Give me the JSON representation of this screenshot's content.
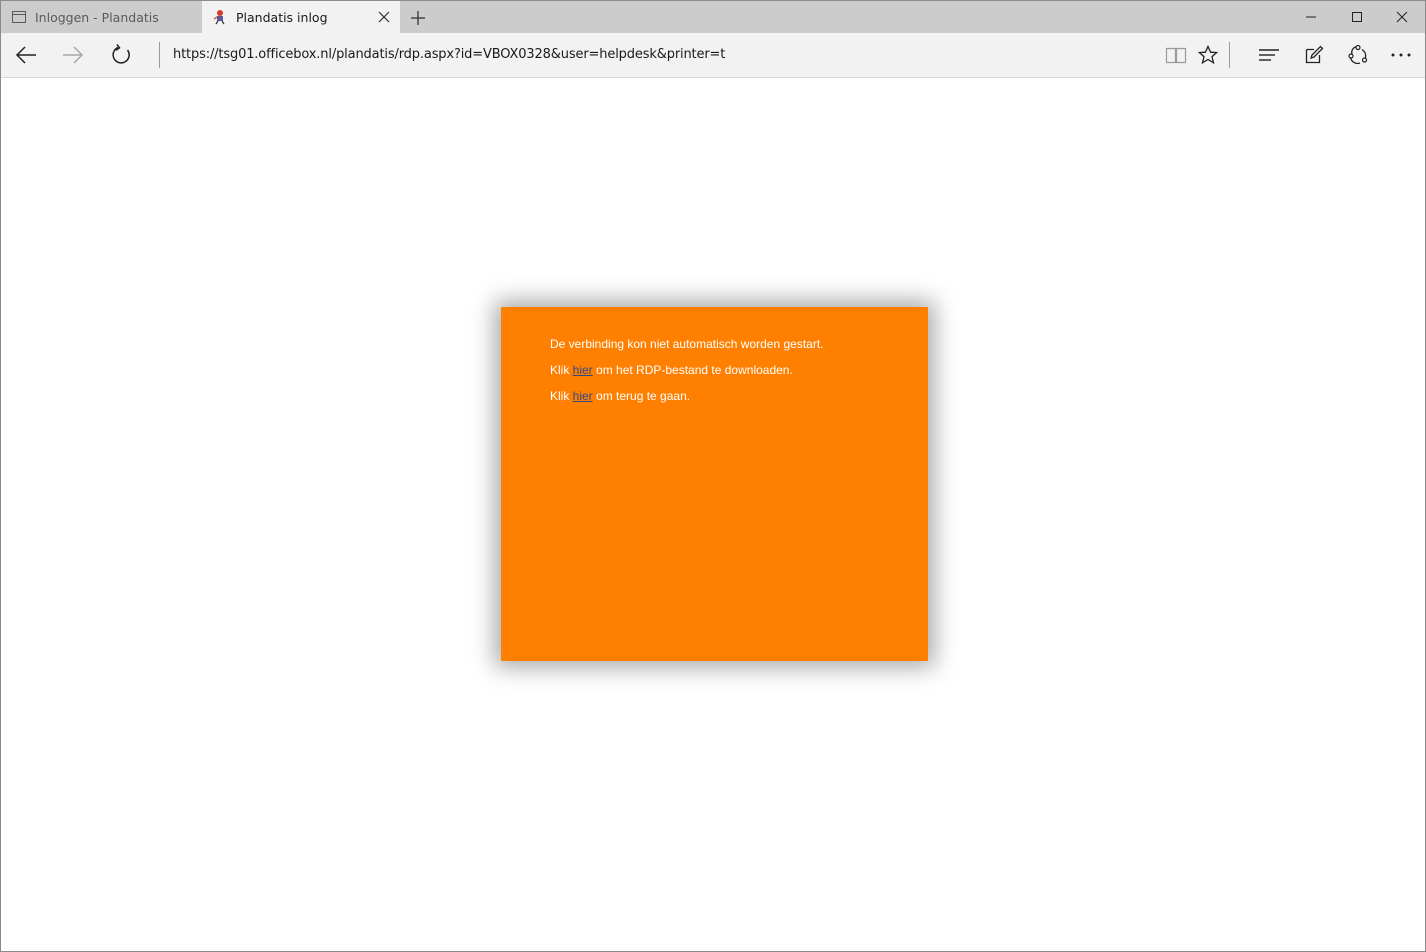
{
  "tabs": [
    {
      "label": "Inloggen - Plandatis",
      "active": false
    },
    {
      "label": "Plandatis inlog",
      "active": true
    }
  ],
  "address": {
    "url": "https://tsg01.officebox.nl/plandatis/rdp.aspx?id=VBOX0328&user=helpdesk&printer=t"
  },
  "panel": {
    "message": "De verbinding kon niet automatisch worden gestart.",
    "line2_prefix": "Klik ",
    "line2_link": "hier",
    "line2_suffix": " om het RDP-bestand te downloaden.",
    "line3_prefix": "Klik ",
    "line3_link": "hier",
    "line3_suffix": " om terug te gaan.",
    "background_color": "#ff8000",
    "link_color": "#2c4a8a"
  },
  "icons": {
    "tab1": "page-icon",
    "tab2": "plandatis-favicon",
    "tab_close": "close-icon",
    "new_tab": "plus-icon",
    "minimize": "minimize-icon",
    "maximize": "maximize-icon",
    "window_close": "close-icon",
    "back": "arrow-left-icon",
    "forward": "arrow-right-icon",
    "refresh": "refresh-icon",
    "reading_view": "book-icon",
    "favorite": "star-icon",
    "hub": "hub-icon",
    "web_note": "pen-icon",
    "share": "share-icon",
    "more": "more-icon"
  }
}
